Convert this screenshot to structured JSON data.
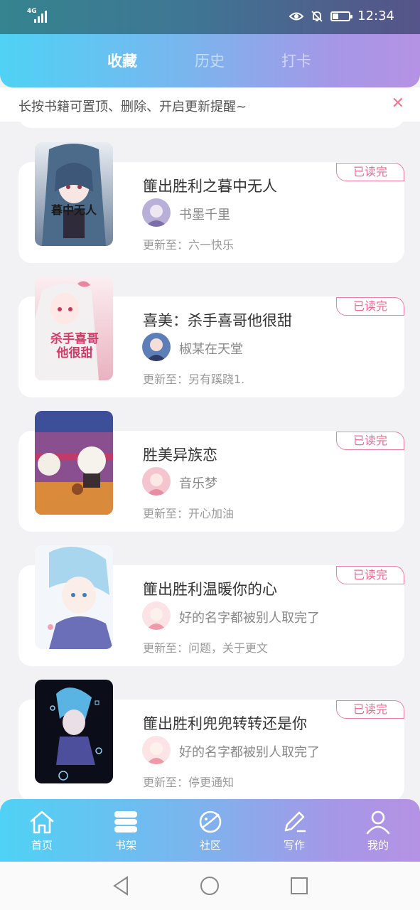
{
  "status_bar": {
    "network": "4G",
    "time": "12:34",
    "battery_level": 0.35
  },
  "tabs": [
    {
      "label": "收藏",
      "active": true
    },
    {
      "label": "历史",
      "active": false
    },
    {
      "label": "打卡",
      "active": false
    }
  ],
  "tip": {
    "text": "长按书籍可置顶、删除、开启更新提醒~",
    "close_symbol": "✕"
  },
  "books": [
    {
      "title": "篚出胜利之暮中无人",
      "author": "书墨千里",
      "update": "更新至：六一快乐",
      "badge": "已读完",
      "cover_text": "暮中无人",
      "cover_colors": [
        "#5c6f86",
        "#a8b9cb"
      ]
    },
    {
      "title": "喜美：杀手喜哥他很甜",
      "author": "椒某在天堂",
      "update": "更新至：另有蹊跷1.",
      "badge": "已读完",
      "cover_text": "杀手喜哥他很甜",
      "cover_colors": [
        "#f6d5dc",
        "#e89aac"
      ]
    },
    {
      "title": "胜美异族恋",
      "author": "音乐梦",
      "update": "更新至：开心加油",
      "badge": "已读完",
      "cover_text": "",
      "cover_colors": [
        "#c44b7a",
        "#f1a83a"
      ]
    },
    {
      "title": "篚出胜利温暖你的心",
      "author": "好的名字都被别人取完了",
      "update": "更新至：问题，关于更文",
      "badge": "已读完",
      "cover_text": "",
      "cover_colors": [
        "#dcecf7",
        "#8fa3d6"
      ]
    },
    {
      "title": "篚出胜利兜兜转转还是你",
      "author": "好的名字都被别人取完了",
      "update": "更新至：停更通知",
      "badge": "已读完",
      "cover_text": "",
      "cover_colors": [
        "#0e1020",
        "#4aa4d9"
      ]
    }
  ],
  "bottom_nav": [
    {
      "label": "首页",
      "icon": "home-icon"
    },
    {
      "label": "书架",
      "icon": "bookshelf-icon"
    },
    {
      "label": "社区",
      "icon": "planet-icon"
    },
    {
      "label": "写作",
      "icon": "pen-icon"
    },
    {
      "label": "我的",
      "icon": "user-icon"
    }
  ],
  "colors": {
    "accent_pink": "#ee6a8c",
    "gradient_start": "#4fd2f5",
    "gradient_end": "#b592e4"
  }
}
